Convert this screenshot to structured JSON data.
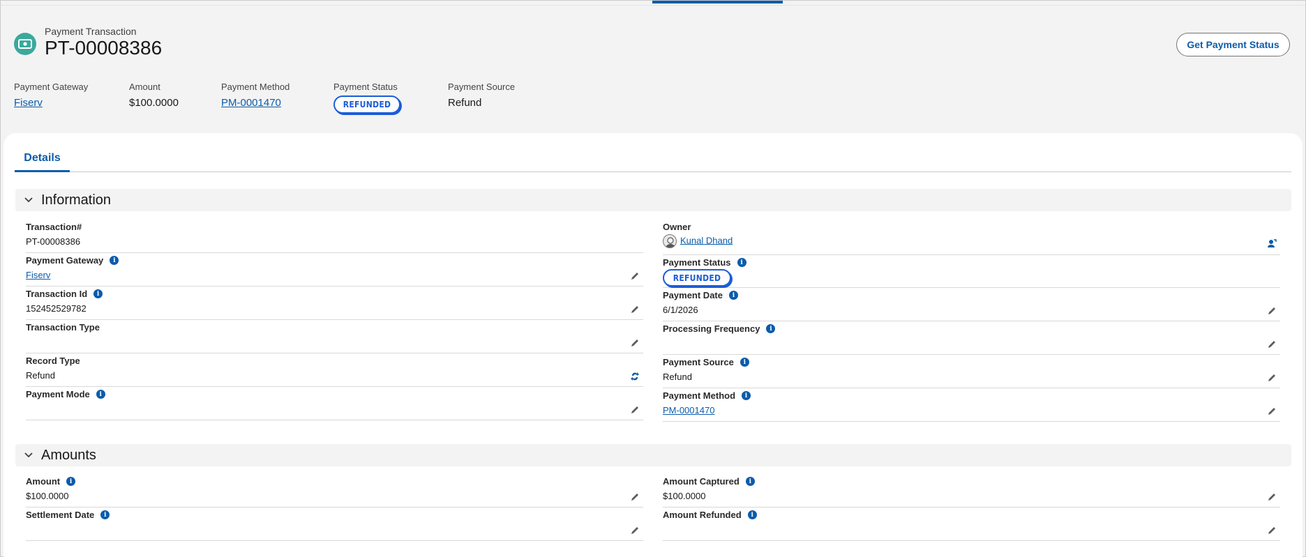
{
  "header": {
    "object_label": "Payment Transaction",
    "record_name": "PT-00008386",
    "action_button": "Get Payment Status",
    "highlights": [
      {
        "label": "Payment Gateway",
        "value": "Fiserv",
        "kind": "link"
      },
      {
        "label": "Amount",
        "value": "$100.0000",
        "kind": "text"
      },
      {
        "label": "Payment Method",
        "value": "PM-0001470",
        "kind": "link"
      },
      {
        "label": "Payment Status",
        "value": "REFUNDED",
        "kind": "badge"
      },
      {
        "label": "Payment Source",
        "value": "Refund",
        "kind": "text"
      }
    ]
  },
  "tabs": {
    "details": "Details"
  },
  "sections": {
    "information": {
      "title": "Information",
      "left": [
        {
          "label": "Transaction#",
          "value": "PT-00008386"
        },
        {
          "label": "Payment Gateway",
          "value": "Fiserv"
        },
        {
          "label": "Transaction Id",
          "value": "152452529782"
        },
        {
          "label": "Transaction Type",
          "value": ""
        },
        {
          "label": "Record Type",
          "value": "Refund"
        },
        {
          "label": "Payment Mode",
          "value": ""
        }
      ],
      "right": [
        {
          "label": "Owner",
          "value": "Kunal Dhand"
        },
        {
          "label": "Payment Status",
          "value": "REFUNDED"
        },
        {
          "label": "Payment Date",
          "value": "6/1/2026"
        },
        {
          "label": "Processing Frequency",
          "value": ""
        },
        {
          "label": "Payment Source",
          "value": "Refund"
        },
        {
          "label": "Payment Method",
          "value": "PM-0001470"
        }
      ]
    },
    "amounts": {
      "title": "Amounts",
      "left": [
        {
          "label": "Amount",
          "value": "$100.0000"
        },
        {
          "label": "Settlement Date",
          "value": ""
        }
      ],
      "right": [
        {
          "label": "Amount Captured",
          "value": "$100.0000"
        },
        {
          "label": "Amount Refunded",
          "value": ""
        }
      ]
    }
  },
  "colors": {
    "brand": "#0b5cab",
    "icon_bg": "#3ba99c",
    "badge": "#1b5dd8"
  }
}
